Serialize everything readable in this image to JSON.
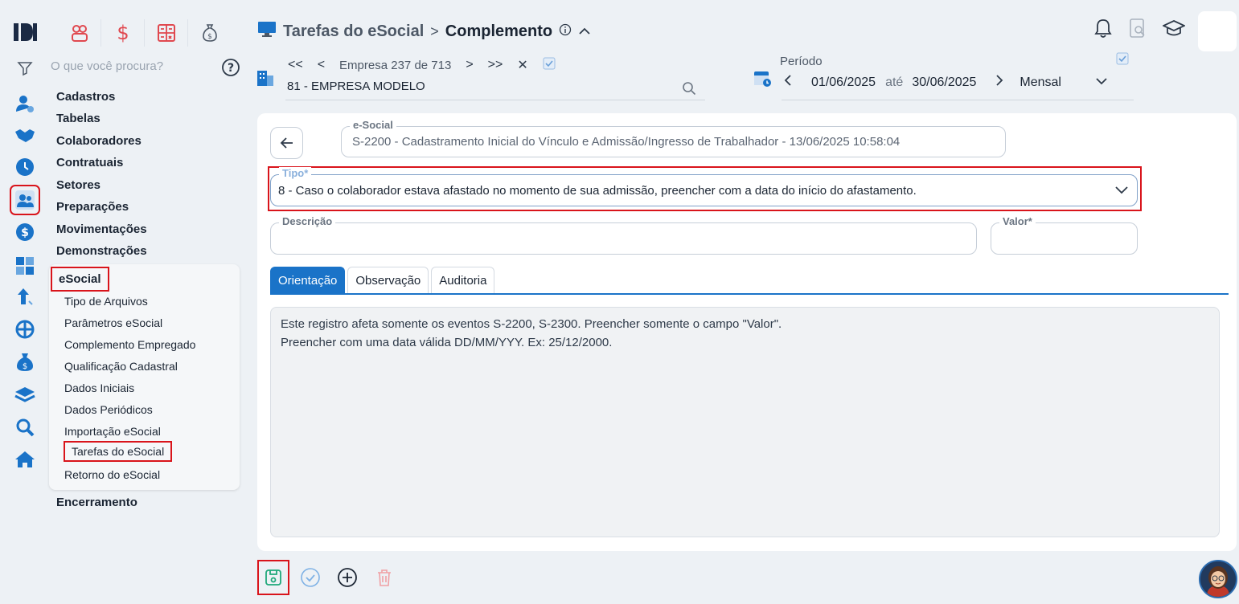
{
  "header": {
    "title": "Tarefas do eSocial",
    "separator": ">",
    "subtitle": "Complemento"
  },
  "search": {
    "placeholder": "O que você procura?"
  },
  "menu": {
    "items": [
      "Cadastros",
      "Tabelas",
      "Colaboradores",
      "Contratuais",
      "Setores",
      "Preparações",
      "Movimentações",
      "Demonstrações"
    ],
    "esocial": {
      "label": "eSocial",
      "items": [
        "Tipo de Arquivos",
        "Parâmetros eSocial",
        "Complemento Empregado",
        "Qualificação Cadastral",
        "Dados Iniciais",
        "Dados Periódicos",
        "Importação eSocial",
        "Tarefas do eSocial",
        "Retorno do eSocial"
      ]
    },
    "last": "Encerramento"
  },
  "empresa": {
    "first": "<<",
    "prev": "<",
    "label": "Empresa",
    "current": "237",
    "of": "de",
    "total": "713",
    "next": ">",
    "last": ">>",
    "close": "✕",
    "name": "81 - EMPRESA MODELO"
  },
  "periodo": {
    "label": "Período",
    "start": "01/06/2025",
    "until": "até",
    "end": "30/06/2025",
    "frequency": "Mensal"
  },
  "form": {
    "esocial_label": "e-Social",
    "esocial_value": "S-2200 - Cadastramento Inicial do Vínculo e Admissão/Ingresso de Trabalhador - 13/06/2025 10:58:04",
    "tipo_label": "Tipo*",
    "tipo_value": "8 - Caso o colaborador estava afastado no momento de sua admissão, preencher com a data do início do afastamento.",
    "descricao_label": "Descrição",
    "descricao_value": "",
    "valor_label": "Valor*",
    "valor_value": ""
  },
  "tabs": [
    "Orientação",
    "Observação",
    "Auditoria"
  ],
  "orientacao": {
    "line1": "Este registro afeta somente os eventos S-2200, S-2300. Preencher somente o campo \"Valor\".",
    "line2": "Preencher com uma data válida DD/MM/YYY. Ex: 25/12/2000."
  },
  "colors": {
    "accent": "#1a73c8",
    "highlight": "#d9141b",
    "save": "#1fa87a"
  }
}
